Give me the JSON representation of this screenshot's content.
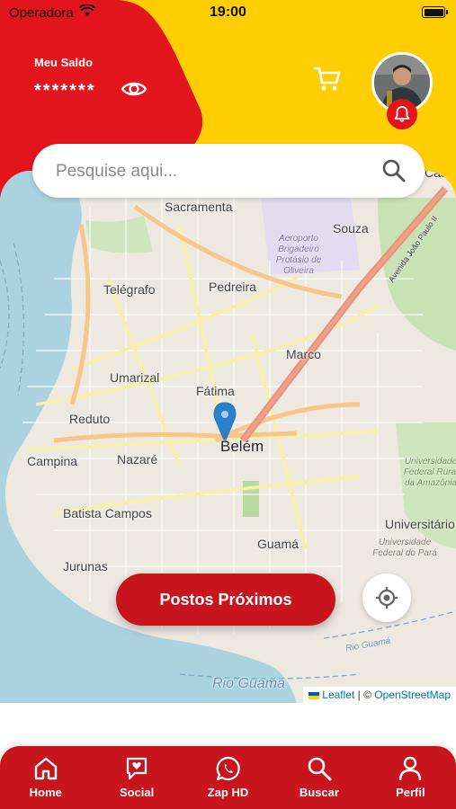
{
  "status_bar": {
    "carrier": "Operadora",
    "time": "19:00"
  },
  "header": {
    "balance_label": "Meu Saldo",
    "balance_value": "*******",
    "eye_icon": "eye-icon",
    "cart_icon": "cart-icon",
    "notification_icon": "bell-icon",
    "colors": {
      "red": "#e2141c",
      "yellow": "#ffce00"
    }
  },
  "search": {
    "placeholder": "Pesquise aqui..."
  },
  "map": {
    "places": {
      "sacramenta": "Sacramenta",
      "souza": "Souza",
      "airport": "Aeroporto Brigadeiro Protásio de Oliveira",
      "telegrafo": "Telégrafo",
      "pedreira": "Pedreira",
      "marco": "Marco",
      "umarizal": "Umarizal",
      "fatima": "Fátima",
      "reduto": "Reduto",
      "belem": "Belém",
      "campina": "Campina",
      "nazare": "Nazaré",
      "batista_campos": "Batista Campos",
      "guama": "Guamá",
      "jurunas": "Jurunas",
      "universitario": "Universitário",
      "ufra": "Universidade Federal Rural da Amazônia",
      "ufpa": "Universidade Federal do Pará",
      "rio_guama": "Rio Guamá",
      "rio_guama_small": "Rio Guamá",
      "avenue": "Avenida João Paulo II",
      "cas": "Cas"
    },
    "attribution": {
      "leaflet": "Leaflet",
      "separator": "| ©",
      "osm": "OpenStreetMap"
    }
  },
  "actions": {
    "near_button": "Postos Próximos",
    "locate_icon": "crosshair-icon"
  },
  "bottom_nav": {
    "items": [
      {
        "label": "Home",
        "icon": "home-icon"
      },
      {
        "label": "Social",
        "icon": "heart-chat-icon"
      },
      {
        "label": "Zap HD",
        "icon": "whatsapp-icon"
      },
      {
        "label": "Buscar",
        "icon": "search-icon"
      },
      {
        "label": "Perfil",
        "icon": "user-icon"
      }
    ]
  }
}
